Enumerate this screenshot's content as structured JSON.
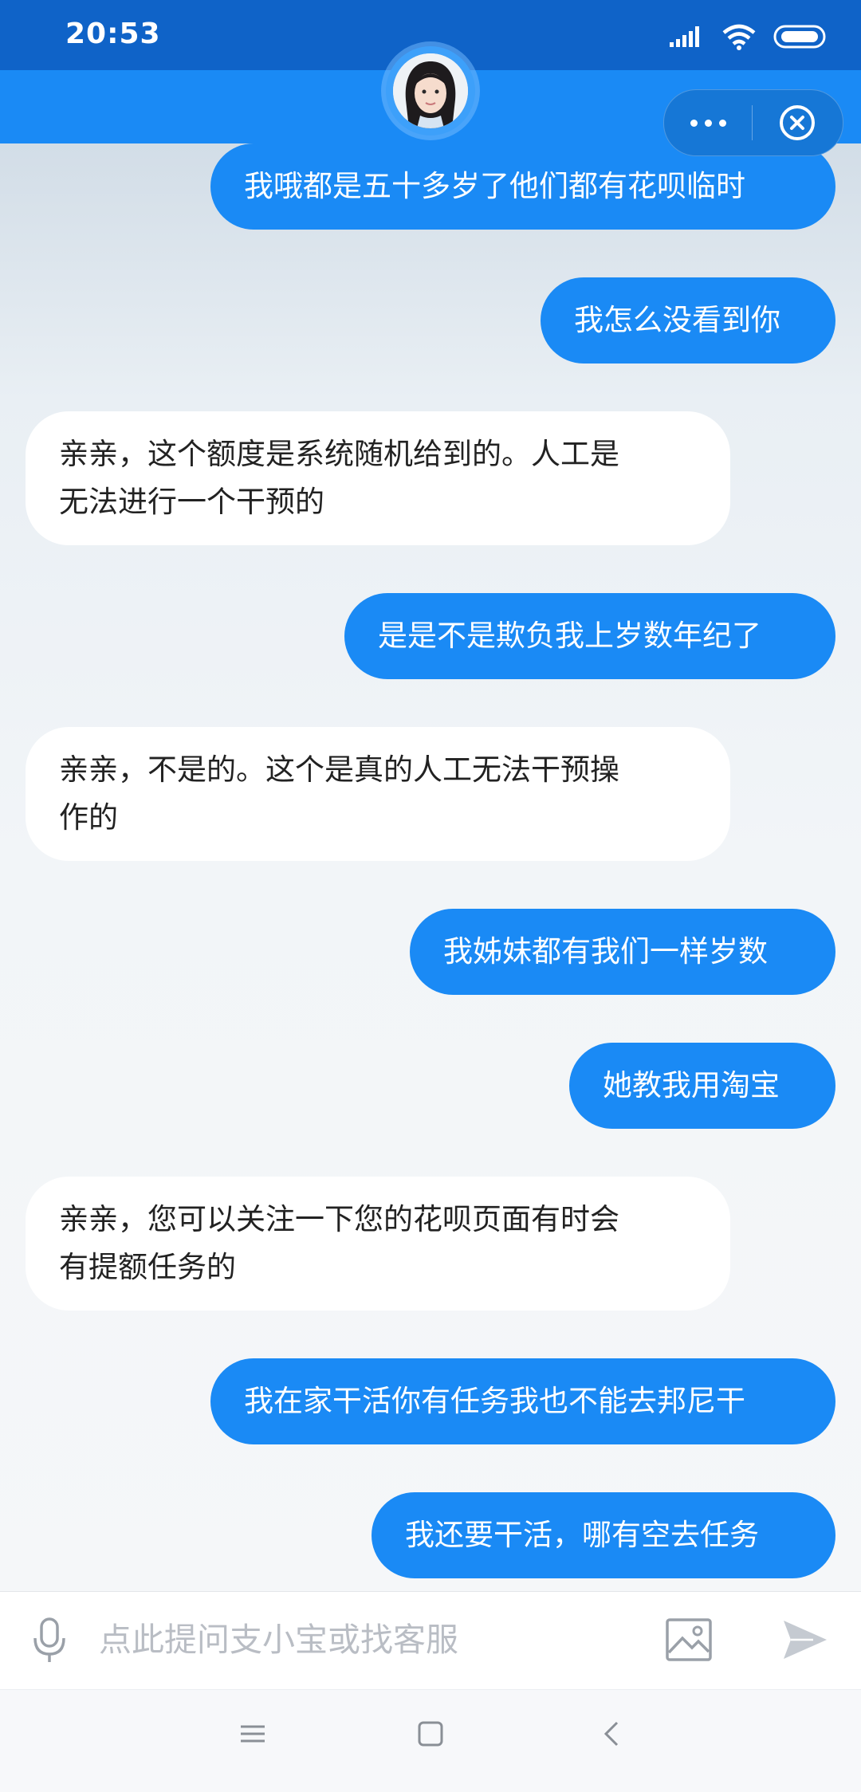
{
  "status_bar": {
    "time": "20:53",
    "icons": [
      "signal-icon",
      "wifi-icon",
      "battery-icon"
    ]
  },
  "header": {
    "avatar": "assistant-avatar",
    "capsule_icons": [
      "more-icon",
      "close-icon"
    ]
  },
  "colors": {
    "accent": "#1a8af5",
    "status_bar": "#0f63c8",
    "outgoing_bubble": "#1a8af5",
    "incoming_bubble": "#ffffff"
  },
  "messages": [
    {
      "side": "out",
      "text": "我哦都是五十多岁了他们都有花呗临时"
    },
    {
      "side": "out",
      "text": "我怎么没看到你"
    },
    {
      "side": "in",
      "text": "亲亲，这个额度是系统随机给到的。人工是\n无法进行一个干预的"
    },
    {
      "side": "out",
      "text": "是是不是欺负我上岁数年纪了"
    },
    {
      "side": "in",
      "text": "亲亲，不是的。这个是真的人工无法干预操\n作的"
    },
    {
      "side": "out",
      "text": "我姊妹都有我们一样岁数"
    },
    {
      "side": "out",
      "text": "她教我用淘宝"
    },
    {
      "side": "in",
      "text": "亲亲，您可以关注一下您的花呗页面有时会\n有提额任务的"
    },
    {
      "side": "out",
      "text": "我在家干活你有任务我也不能去邦尼干"
    },
    {
      "side": "out",
      "text": "我还要干活，哪有空去任务"
    }
  ],
  "input": {
    "placeholder": "点此提问支小宝或找客服",
    "icons": [
      "microphone-icon",
      "image-icon",
      "send-icon"
    ]
  },
  "nav_bar": {
    "icons": [
      "menu-icon",
      "home-icon",
      "back-icon"
    ]
  }
}
